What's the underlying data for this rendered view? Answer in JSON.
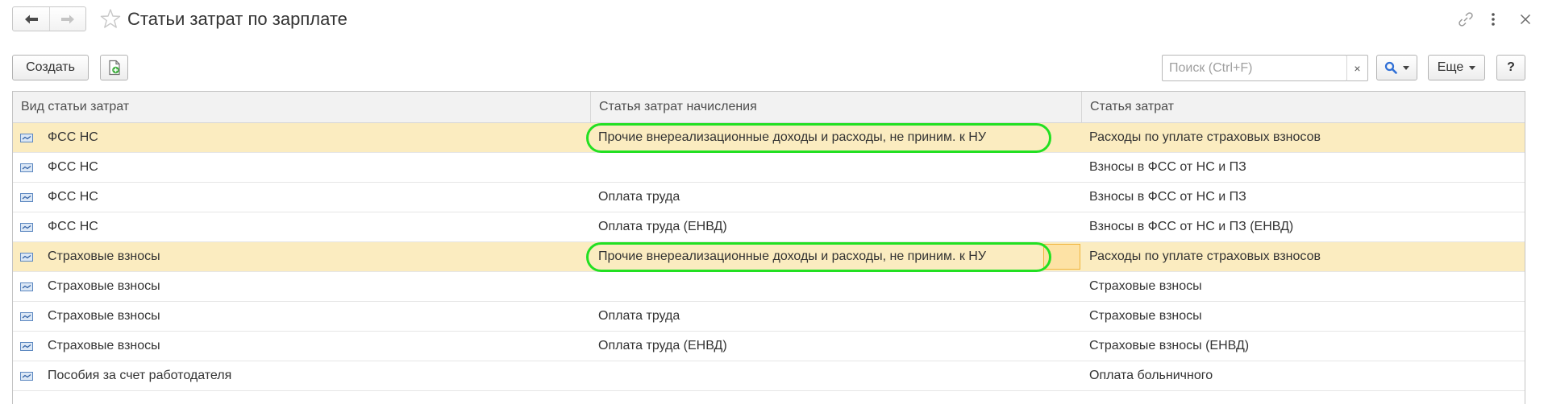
{
  "window": {
    "title": "Статьи затрат по зарплате",
    "icons": {
      "back": "arrow-left-icon",
      "forward": "arrow-right-icon",
      "favorite": "star-icon",
      "link": "link-icon",
      "more": "more-vertical-icon",
      "close": "close-icon"
    }
  },
  "toolbar": {
    "create_label": "Создать",
    "add_icon": "add-document-icon",
    "search": {
      "placeholder": "Поиск (Ctrl+F)",
      "value": "",
      "clear_label": "×",
      "search_icon": "magnifier-icon"
    },
    "more_label": "Еще",
    "help_label": "?"
  },
  "table": {
    "columns": [
      "Вид статьи затрат",
      "Статья затрат начисления",
      "Статья затрат"
    ],
    "rows": [
      {
        "kind": "ФСС НС",
        "accrual_cost_item": "Прочие внереализационные доходы и расходы, не приним. к НУ",
        "cost_item": "Расходы по уплате страховых взносов",
        "highlighted": true,
        "circled": true,
        "focused": false
      },
      {
        "kind": "ФСС НС",
        "accrual_cost_item": "",
        "cost_item": "Взносы в ФСС от НС и ПЗ",
        "highlighted": false,
        "circled": false,
        "focused": false
      },
      {
        "kind": "ФСС НС",
        "accrual_cost_item": "Оплата труда",
        "cost_item": "Взносы в ФСС от НС и ПЗ",
        "highlighted": false,
        "circled": false,
        "focused": false
      },
      {
        "kind": "ФСС НС",
        "accrual_cost_item": "Оплата труда (ЕНВД)",
        "cost_item": "Взносы в ФСС от НС и ПЗ (ЕНВД)",
        "highlighted": false,
        "circled": false,
        "focused": false
      },
      {
        "kind": "Страховые взносы",
        "accrual_cost_item": "Прочие внереализационные доходы и расходы, не приним. к НУ",
        "cost_item": "Расходы по уплате страховых взносов",
        "highlighted": true,
        "circled": true,
        "focused": true
      },
      {
        "kind": "Страховые взносы",
        "accrual_cost_item": "",
        "cost_item": "Страховые взносы",
        "highlighted": false,
        "circled": false,
        "focused": false
      },
      {
        "kind": "Страховые взносы",
        "accrual_cost_item": "Оплата труда",
        "cost_item": "Страховые взносы",
        "highlighted": false,
        "circled": false,
        "focused": false
      },
      {
        "kind": "Страховые взносы",
        "accrual_cost_item": "Оплата труда (ЕНВД)",
        "cost_item": "Страховые взносы (ЕНВД)",
        "highlighted": false,
        "circled": false,
        "focused": false
      },
      {
        "kind": "Пособия за счет работодателя",
        "accrual_cost_item": "",
        "cost_item": "Оплата больничного",
        "highlighted": false,
        "circled": false,
        "focused": false
      }
    ],
    "row_icon": "catalog-item-icon"
  },
  "colors": {
    "highlight_row": "#fbecc0",
    "annotation_circle": "#22e022",
    "focus_cell": "#fde2a5",
    "search_icon": "#2f6fd6"
  }
}
